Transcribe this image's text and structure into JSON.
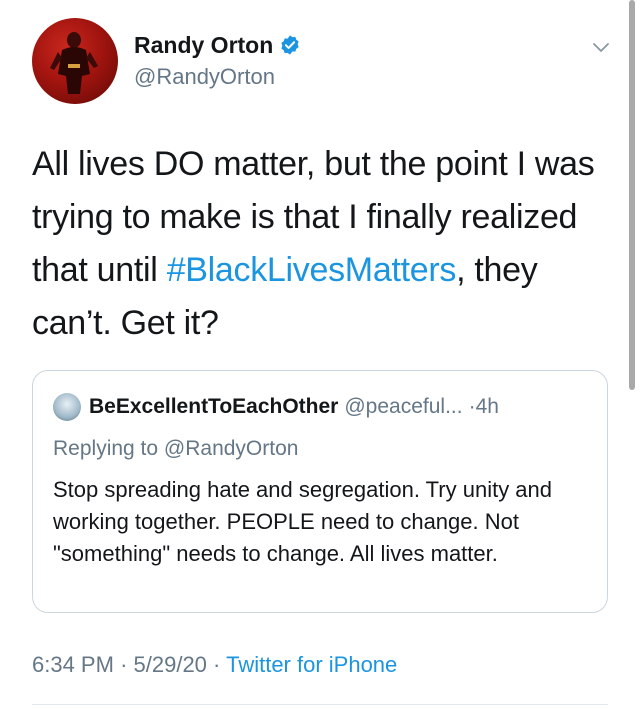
{
  "author": {
    "display_name": "Randy Orton",
    "handle": "@RandyOrton",
    "verified_icon": "verified-badge-icon"
  },
  "tweet": {
    "text_before": "All lives DO matter, but the point I was trying to make is that I finally realized that until ",
    "hashtag": "#BlackLivesMatters",
    "text_after": ", they can’t. Get it?"
  },
  "quoted": {
    "display_name": "BeExcellentToEachOther",
    "handle": "@peaceful...",
    "separator": "·",
    "time": "4h",
    "replying_prefix": "Replying to",
    "replying_to": "@RandyOrton",
    "text": "Stop spreading hate and segregation. Try unity and working together. PEOPLE need to change. Not \"something\" needs to change. All lives matter."
  },
  "meta": {
    "time": "6:34 PM",
    "sep1": "·",
    "date": "5/29/20",
    "sep2": "·",
    "source": "Twitter for iPhone"
  },
  "colors": {
    "link": "#1b95e0",
    "secondary": "#657786",
    "border": "#ccd6dd"
  }
}
